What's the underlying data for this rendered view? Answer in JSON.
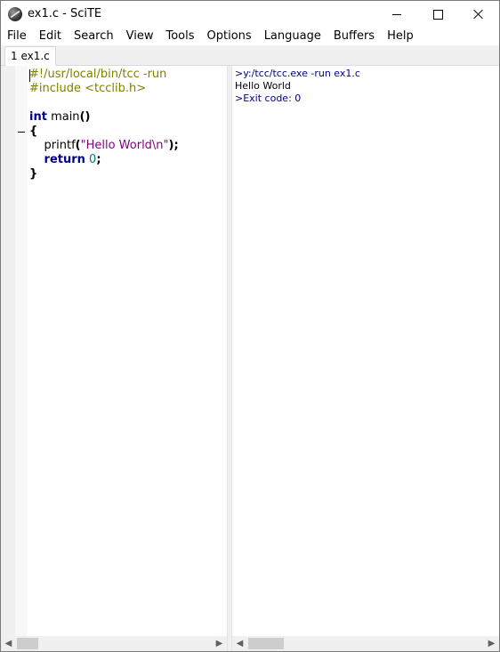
{
  "window": {
    "title": "ex1.c - SciTE"
  },
  "menu": [
    "File",
    "Edit",
    "Search",
    "View",
    "Tools",
    "Options",
    "Language",
    "Buffers",
    "Help"
  ],
  "tabs": [
    {
      "label": "1 ex1.c"
    }
  ],
  "editor": {
    "lines": [
      [
        {
          "text": "#!/usr/local/bin/tcc -run",
          "cls": "c-pre"
        }
      ],
      [
        {
          "text": "#include <tcclib.h>",
          "cls": "c-pre"
        }
      ],
      [
        {
          "text": "",
          "cls": "c-plain"
        }
      ],
      [
        {
          "text": "int",
          "cls": "c-kw"
        },
        {
          "text": " main",
          "cls": "c-plain"
        },
        {
          "text": "()",
          "cls": "c-op"
        }
      ],
      [
        {
          "text": "{",
          "cls": "c-op"
        }
      ],
      [
        {
          "text": "    printf",
          "cls": "c-plain"
        },
        {
          "text": "(",
          "cls": "c-op"
        },
        {
          "text": "\"Hello World\\n\"",
          "cls": "c-str"
        },
        {
          "text": ");",
          "cls": "c-op"
        }
      ],
      [
        {
          "text": "    ",
          "cls": "c-plain"
        },
        {
          "text": "return",
          "cls": "c-kw"
        },
        {
          "text": " ",
          "cls": "c-plain"
        },
        {
          "text": "0",
          "cls": "c-num"
        },
        {
          "text": ";",
          "cls": "c-op"
        }
      ],
      [
        {
          "text": "}",
          "cls": "c-op"
        }
      ]
    ]
  },
  "output": {
    "lines": [
      {
        "text": ">y:/tcc/tcc.exe -run ex1.c",
        "cls": "out-cmd"
      },
      {
        "text": "Hello World",
        "cls": "out-text"
      },
      {
        "text": ">Exit code: 0",
        "cls": "out-cmd"
      }
    ]
  },
  "icons": {
    "app": "scite-app-icon",
    "minimize": "minimize-icon",
    "maximize": "maximize-icon",
    "close": "close-icon",
    "scroll_left": "◀",
    "scroll_right": "▶"
  }
}
